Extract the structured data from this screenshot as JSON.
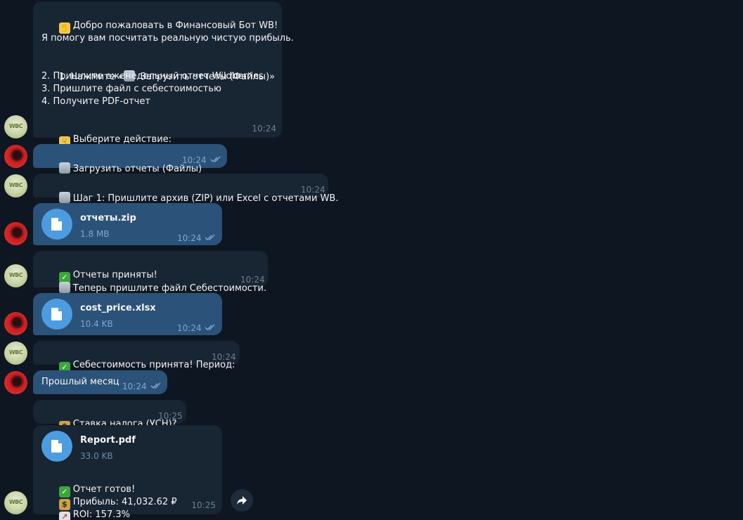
{
  "bot_avatar_label": "WBC",
  "messages": {
    "welcome": {
      "title": "Добро пожаловать в Финансовый Бот WB!",
      "intro": "Я помогу вам посчитать реальную чистую прибыль.",
      "step1_pre": "1. Нажмите «",
      "step1_post": " Загрузить отчеты (Файлы)»",
      "step2": "2. Пришлите еженедельный отчет Wildberries",
      "step3": "3. Пришлите файл с себестоимостью",
      "step4": "4. Получите PDF-отчет",
      "choose": "Выберите действие:",
      "time": "10:24"
    },
    "upload_btn": {
      "text": "Загрузить отчеты (Файлы)",
      "time": "10:24"
    },
    "step1": {
      "text": "Шаг 1: Пришлите архив (ZIP) или Excel с отчетами WB.",
      "time": "10:24"
    },
    "file_zip": {
      "name": "отчеты.zip",
      "size": "1.8 MB",
      "time": "10:24"
    },
    "accepted": {
      "line1": "Отчеты приняты!",
      "line2": "Теперь пришлите файл Себестоимости.",
      "time": "10:24"
    },
    "file_cost": {
      "name": "cost_price.xlsx",
      "size": "10.4 KB",
      "time": "10:24"
    },
    "cost_ok": {
      "text": "Себестоимость принята! Период:",
      "time": "10:24"
    },
    "period": {
      "text": "Прошлый месяц",
      "time": "10:24"
    },
    "tax": {
      "text": "Ставка налога (УСН)?",
      "time": "10:25"
    },
    "report": {
      "name": "Report.pdf",
      "size": "33.0 KB",
      "ready": "Отчет готов!",
      "profit": "Прибыль: 41,032.62 ₽",
      "roi": "ROI: 157.3%",
      "time": "10:25"
    }
  },
  "colors": {
    "background": "#0e1621",
    "incoming": "#182533",
    "outgoing": "#2b5278",
    "file_icon": "#4d9ce0"
  },
  "icons": [
    "waving-hand-icon",
    "folder-icon",
    "pointing-down-icon",
    "check-mark-icon",
    "money-bag-icon",
    "chart-icon",
    "document-icon",
    "double-check-icon",
    "forward-icon"
  ]
}
